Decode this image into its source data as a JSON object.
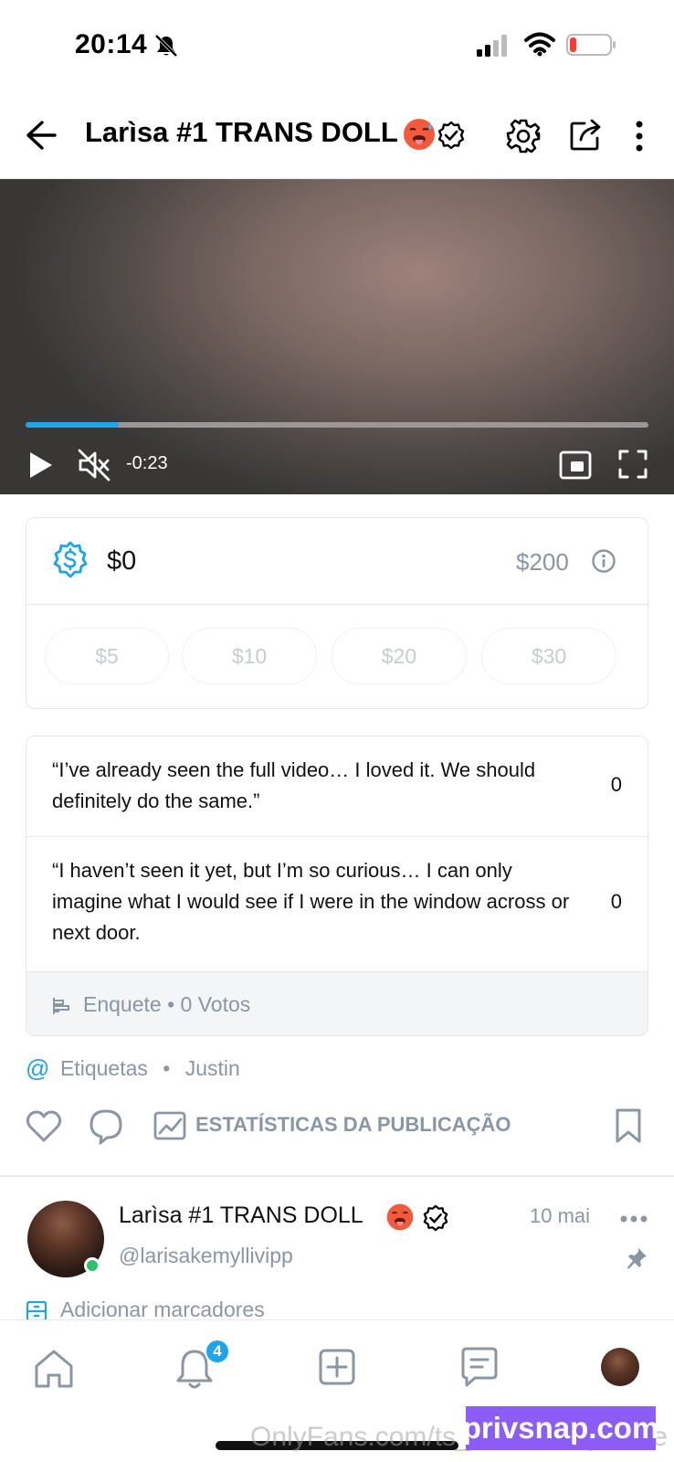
{
  "status_bar": {
    "time": "20:14"
  },
  "header": {
    "title": "Larìsa #1 TRANS DOLL"
  },
  "video": {
    "time_remaining": "-0:23",
    "progress": 0.15
  },
  "tip_goal": {
    "current": "$0",
    "goal": "$200",
    "amounts": [
      "$5",
      "$10",
      "$20",
      "$30"
    ]
  },
  "poll": {
    "options": [
      {
        "text": "“I’ve already seen the full video… I loved it. We should definitely do the same.”",
        "count": "0"
      },
      {
        "text": "“I haven’t seen it yet, but I’m so curious… I can only imagine what I would see if I were in the window across or next door.",
        "count": "0"
      }
    ],
    "footer": "Enquete • 0 Votos"
  },
  "tags": {
    "icon": "@",
    "label": "Etiquetas",
    "separator": "•",
    "value": "Justin"
  },
  "actions": {
    "stats_label": "ESTATÍSTICAS DA PUBLICAÇÃO"
  },
  "next_post": {
    "name": "Larìsa #1 TRANS DOLL",
    "handle": "@larisakemyllivipp",
    "date": "10 mai",
    "add_markers": "Adicionar marcadores"
  },
  "bottom_nav": {
    "notification_badge": "4"
  },
  "overlay": {
    "watermark": "OnlyFans.com/ts_larisakemyllifree",
    "brand": "privsnap.com"
  },
  "colors": {
    "accent": "#1ea4e8",
    "muted": "#8a96a3",
    "online": "#2cc26b",
    "brand_bg": "#8b5cf6"
  }
}
